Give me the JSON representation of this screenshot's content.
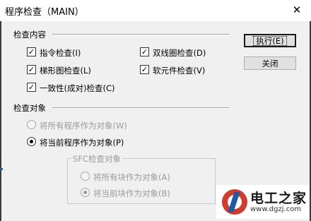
{
  "window": {
    "title": "程序检查（MAIN）",
    "close_glyph": "✕"
  },
  "check_content": {
    "label": "检查内容",
    "options": [
      {
        "label": "指令检查(I)",
        "checked": true
      },
      {
        "label": "双线圈检查(D)",
        "checked": true
      },
      {
        "label": "梯形图检查(L)",
        "checked": true
      },
      {
        "label": "软元件检查(V)",
        "checked": true
      },
      {
        "label": "一致性(成对)检查(C)",
        "checked": true
      }
    ]
  },
  "buttons": {
    "execute": "执行(E)",
    "close": "关闭"
  },
  "check_target": {
    "label": "检查对象",
    "options": [
      {
        "label": "将所有程序作为对象(W)",
        "selected": false,
        "enabled": false
      },
      {
        "label": "将当前程序作为对象(P)",
        "selected": true,
        "enabled": true
      }
    ]
  },
  "sfc_target": {
    "label": "SFC检查对象",
    "options": [
      {
        "label": "将所有块作为对象(A)",
        "selected": false,
        "enabled": false
      },
      {
        "label": "将当前块作为对象(B)",
        "selected": true,
        "enabled": false
      }
    ]
  },
  "watermark": {
    "title": "电工之家",
    "url": "www.dgzj.com"
  },
  "colors": {
    "dialog_bg": "#f0f0f0",
    "disabled_text": "#9a9a9a",
    "logo_red": "#d33a2c",
    "logo_blue": "#1a5aa8"
  }
}
